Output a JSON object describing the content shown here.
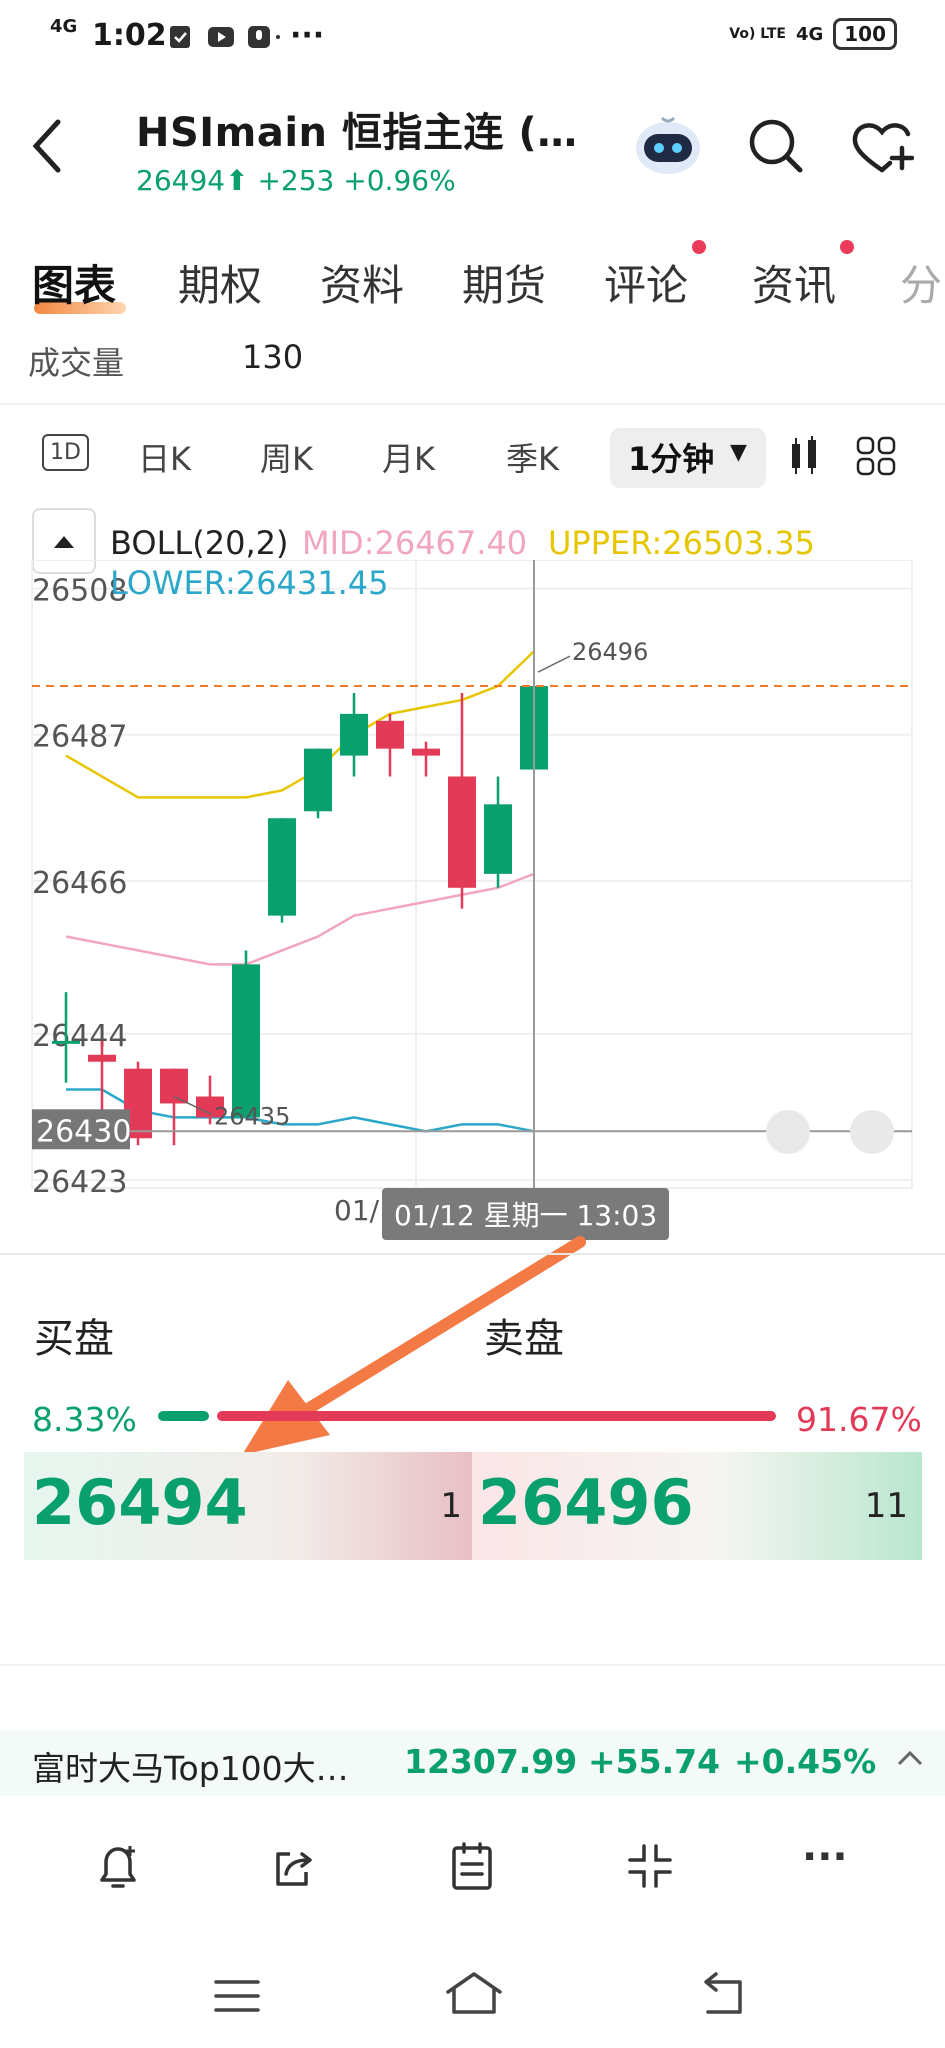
{
  "status_bar": {
    "signal": "4G",
    "time": "1:02",
    "network_right": "4G",
    "volte": "Vo) LTE",
    "battery": "100"
  },
  "header": {
    "title": "HSImain  恒指主连 (…",
    "price": "26494",
    "change": "+253",
    "change_pct": "+0.96%"
  },
  "tabs": [
    "图表",
    "期权",
    "资料",
    "期货",
    "评论",
    "资讯",
    "分"
  ],
  "volume": {
    "label": "成交量",
    "value": "130"
  },
  "periods": [
    "1D",
    "日K",
    "周K",
    "月K",
    "季K",
    "1分钟"
  ],
  "indicator": {
    "name": "BOLL(20,2)",
    "mid": "MID:26467.40",
    "upper": "UPPER:26503.35",
    "lower": "LOWER:26431.45"
  },
  "chart_data": {
    "type": "candlestick",
    "y_ticks": [
      "26508",
      "26487",
      "26466",
      "26444",
      "26430",
      "26423"
    ],
    "ylim": [
      26423,
      26508
    ],
    "crosshair_price": "26430",
    "high_marker": "26496",
    "low_marker": "26435",
    "current_price_line": 26494,
    "candles": [
      {
        "open": 26443,
        "close": 26443,
        "high": 26450,
        "low": 26437
      },
      {
        "open": 26441,
        "close": 26440,
        "high": 26443,
        "low": 26430
      },
      {
        "open": 26439,
        "close": 26429,
        "high": 26440,
        "low": 26428
      },
      {
        "open": 26439,
        "close": 26434,
        "high": 26439,
        "low": 26428
      },
      {
        "open": 26435,
        "close": 26432,
        "high": 26438,
        "low": 26431
      },
      {
        "open": 26432,
        "close": 26454,
        "high": 26456,
        "low": 26432
      },
      {
        "open": 26461,
        "close": 26475,
        "high": 26475,
        "low": 26460
      },
      {
        "open": 26476,
        "close": 26485,
        "high": 26485,
        "low": 26475
      },
      {
        "open": 26484,
        "close": 26490,
        "high": 26493,
        "low": 26481
      },
      {
        "open": 26489,
        "close": 26485,
        "high": 26490,
        "low": 26481
      },
      {
        "open": 26485,
        "close": 26484,
        "high": 26486,
        "low": 26481
      },
      {
        "open": 26481,
        "close": 26465,
        "high": 26493,
        "low": 26462
      },
      {
        "open": 26467,
        "close": 26477,
        "high": 26481,
        "low": 26465
      },
      {
        "open": 26482,
        "close": 26494,
        "high": 26494,
        "low": 26482
      }
    ],
    "boll_upper": [
      26484,
      26481,
      26478,
      26478,
      26478,
      26478,
      26479,
      26482,
      26487,
      26490,
      26491,
      26492,
      26494,
      26499
    ],
    "boll_mid": [
      26458,
      26457,
      26456,
      26455,
      26454,
      26454,
      26456,
      26458,
      26461,
      26462,
      26463,
      26464,
      26465,
      26467
    ],
    "boll_lower": [
      26436,
      26436,
      26433,
      26432,
      26432,
      26432,
      26431,
      26431,
      26432,
      26431,
      26430,
      26431,
      26431,
      26430
    ],
    "x_label": "01/",
    "crosshair_time": "01/12 星期一 13:03"
  },
  "order_book": {
    "bid_label": "买盘",
    "ask_label": "卖盘",
    "bid_pct": "8.33%",
    "ask_pct": "91.67%",
    "bid_ratio": 0.0833,
    "bid_price": "26494",
    "bid_qty": "1",
    "ask_price": "26496",
    "ask_qty": "11"
  },
  "ticker": {
    "name": "富时大马Top100大…",
    "price": "12307.99",
    "change": "+55.74",
    "change_pct": "+0.45%"
  },
  "colors": {
    "up": "#0aa06e",
    "down": "#e23a57",
    "boll_upper": "#e6c600",
    "boll_mid": "#f1a6bd",
    "boll_lower": "#2aa7c9",
    "accent": "#f07a2a"
  }
}
